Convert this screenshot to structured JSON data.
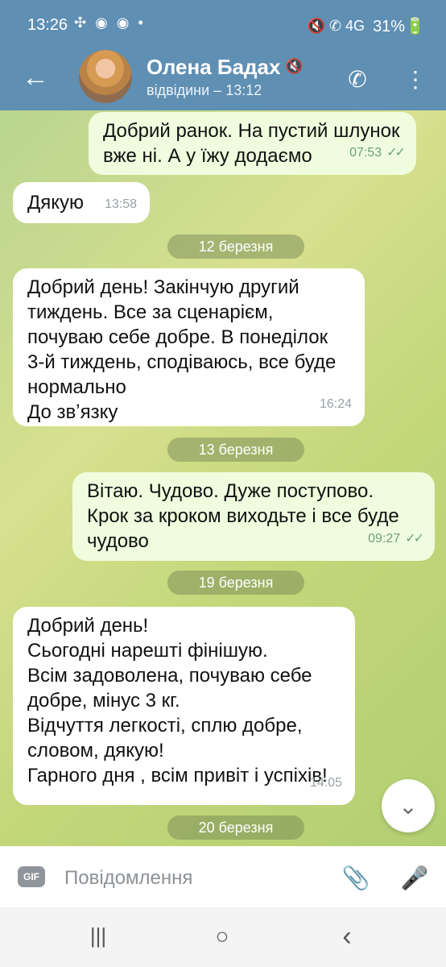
{
  "status_bar": {
    "time": "13:26",
    "left_icons": "✣ ◉ ◉ •",
    "right_icons": "🔇 ✆ 4G",
    "battery": "31%🔋"
  },
  "header": {
    "name": "Олена Бадах",
    "last_seen": "відвідини – 13:12",
    "mute_icon": "🔇",
    "back_icon": "←",
    "call_icon": "✆",
    "more_icon": "⋮"
  },
  "messages": [
    {
      "direction": "out",
      "text": "Добрий ранок. На пустий шлунок\nвже ні. А у їжу додаємо",
      "time": "07:53",
      "read": "✓✓"
    },
    {
      "direction": "in",
      "text": "Дякую",
      "time": "13:58"
    }
  ],
  "dates": [
    {
      "text": "12 березня"
    },
    {
      "text": "13 березня"
    },
    {
      "text": "19 березня"
    },
    {
      "text": "20 березня"
    }
  ],
  "messages_after_12": [
    {
      "direction": "in",
      "text": "Добрий день! Закінчую другий\nтиждень. Все за сценарієм,\nпочуваю себе добре. В понеділок\n3-й тиждень, сподіваюсь, все буде\nнормально\nДо звʼязку",
      "time": "16:24"
    }
  ],
  "messages_after_13": [
    {
      "direction": "out",
      "text": "Вітаю. Чудово. Дуже поступово.\nКрок за кроком виходьте і все буде\nчудово",
      "time": "09:27",
      "read": "✓✓"
    }
  ],
  "messages_after_19": [
    {
      "direction": "in",
      "text": "Добрий день!\nСьогодні нарешті фінішую.\nВсім задоволена, почуваю себе\nдобре, мінус 3 кг.\nВідчуття легкості, сплю добре,\nсловом, дякую!\nГарного дня , всім привіт і успіхів!",
      "time": "14:05"
    }
  ],
  "composer": {
    "gif": "GIF",
    "placeholder": "Повідомлення",
    "attach_icon": "📎",
    "mic_icon": "🎤"
  },
  "nav": {
    "recents": "|||",
    "home": "○",
    "back": "‹"
  },
  "colors": {
    "header": "#5f8fb3",
    "outgoing_bubble": "#effdde",
    "incoming_bubble": "#ffffff"
  }
}
